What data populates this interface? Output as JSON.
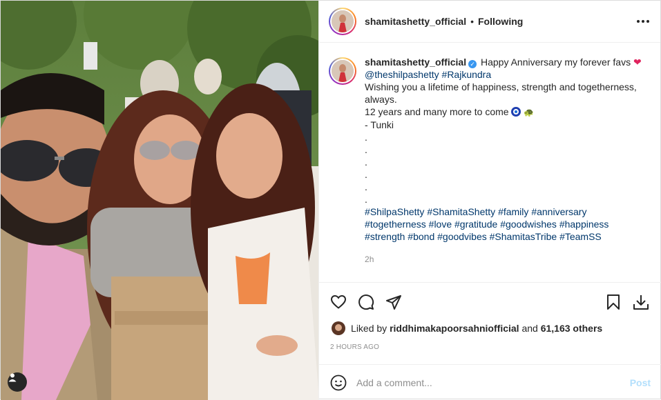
{
  "post": {
    "username": "shamitashetty_official",
    "follow_status": "Following",
    "separator": "•",
    "caption": {
      "username": "shamitashetty_official",
      "line1_text": "Happy Anniversary my forever favs",
      "mention": "@theshilpashetty",
      "hashtag_top": "#Rajkundra",
      "line3": "Wishing you a lifetime of happiness, strength and togetherness, always.",
      "line4": "12 years and many more to come",
      "signature": "- Tunki",
      "dots": [
        ".",
        ".",
        ".",
        ".",
        ".",
        "."
      ],
      "hashtags": [
        "#ShilpaShetty",
        "#ShamitaShetty",
        "#family",
        "#anniversary",
        "#togetherness",
        "#love",
        "#gratitude",
        "#goodwishes",
        "#happiness",
        "#strength",
        "#bond",
        "#goodvibes",
        "#ShamitasTribe",
        "#TeamSS"
      ]
    },
    "time_ago": "2h",
    "likes": {
      "prefix": "Liked by",
      "user": "riddhimakapoorsahniofficial",
      "and": "and",
      "count": "61,163 others"
    },
    "date": "2 HOURS AGO",
    "comment": {
      "placeholder": "Add a comment...",
      "post_label": "Post"
    },
    "icons": {
      "like": "heart-icon",
      "comment": "comment-icon",
      "share": "share-icon",
      "save": "bookmark-icon",
      "download": "download-icon",
      "emoji": "emoji-icon",
      "tag": "user-tag-icon",
      "more": "more-icon"
    },
    "colors": {
      "link": "#00376b",
      "verified": "#3897f0",
      "post_button": "#b2dffc",
      "muted": "#8e8e8e"
    }
  }
}
